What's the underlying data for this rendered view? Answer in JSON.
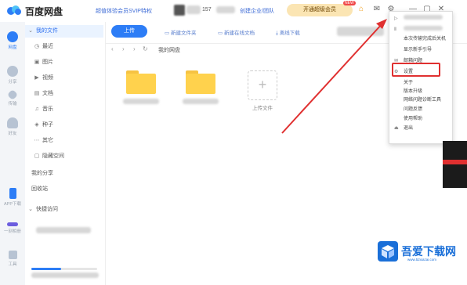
{
  "app": {
    "title": "百度网盘"
  },
  "header": {
    "vip_link": "超值体验会员SVIP特权",
    "username_tail": "157",
    "enterprise_link": "创建企业/团队",
    "open_super": "开通超级会员",
    "badge_new": "NEW"
  },
  "rail": [
    {
      "id": "netdisk",
      "label": "网盘",
      "color": "#2d7df6"
    },
    {
      "id": "share",
      "label": "分享",
      "color": "#b7c3d3"
    },
    {
      "id": "transfer",
      "label": "传输",
      "color": "#b7c3d3"
    },
    {
      "id": "friends",
      "label": "好友",
      "color": "#b7c3d3"
    },
    {
      "id": "app-download",
      "label": "APP下载",
      "color": "#2d7df6"
    },
    {
      "id": "one-click",
      "label": "一刻相册",
      "color": "#6b5ddf"
    },
    {
      "id": "tools",
      "label": "工具",
      "color": "#b7c3d3"
    }
  ],
  "sidebar": {
    "all_files": "我的文件",
    "items": [
      {
        "icon": "clock-icon",
        "glyph": "◷",
        "label": "最近"
      },
      {
        "icon": "image-icon",
        "glyph": "▣",
        "label": "图片"
      },
      {
        "icon": "video-icon",
        "glyph": "▶",
        "label": "视频"
      },
      {
        "icon": "doc-icon",
        "glyph": "▤",
        "label": "文档"
      },
      {
        "icon": "music-icon",
        "glyph": "♫",
        "label": "音乐"
      },
      {
        "icon": "seed-icon",
        "glyph": "◈",
        "label": "种子"
      },
      {
        "icon": "more-icon",
        "glyph": "⋯",
        "label": "其它"
      },
      {
        "icon": "lock-icon",
        "glyph": "▢",
        "label": "隐藏空间"
      }
    ],
    "my_share": "我的分享",
    "recycle": "回收站",
    "quick_access": "快捷访问",
    "storage_fraction": 0.45
  },
  "toolbar": {
    "upload": "上传",
    "new_folder": "新建文件夹",
    "new_online_doc": "新建在线文档",
    "offline_download": "离线下载"
  },
  "breadcrumb": "我的网盘",
  "files": {
    "upload_label": "上传文件"
  },
  "menu": {
    "items": [
      {
        "glyph": "▷",
        "label": ""
      },
      {
        "glyph": "Ⅱ",
        "label": ""
      },
      {
        "glyph": "",
        "label": "本次传输完成后关机"
      },
      {
        "glyph": "",
        "label": "显示新手引导"
      },
      {
        "glyph": "✉",
        "label": "邮箱问题"
      },
      {
        "glyph": "⚙",
        "label": "设置"
      },
      {
        "glyph": "",
        "label": "关于"
      },
      {
        "glyph": "",
        "label": "版本升级"
      },
      {
        "glyph": "",
        "label": "网络问题诊断工具"
      },
      {
        "glyph": "",
        "label": "问题反馈"
      },
      {
        "glyph": "",
        "label": "使用帮助"
      },
      {
        "glyph": "⏏",
        "label": "退出"
      }
    ]
  },
  "watermark": {
    "title": "吾爱下载网",
    "url": "www.52xiazai.com"
  },
  "colors": {
    "accent": "#2d7df6",
    "highlight": "#e03030",
    "folder": "#ffd24d"
  }
}
